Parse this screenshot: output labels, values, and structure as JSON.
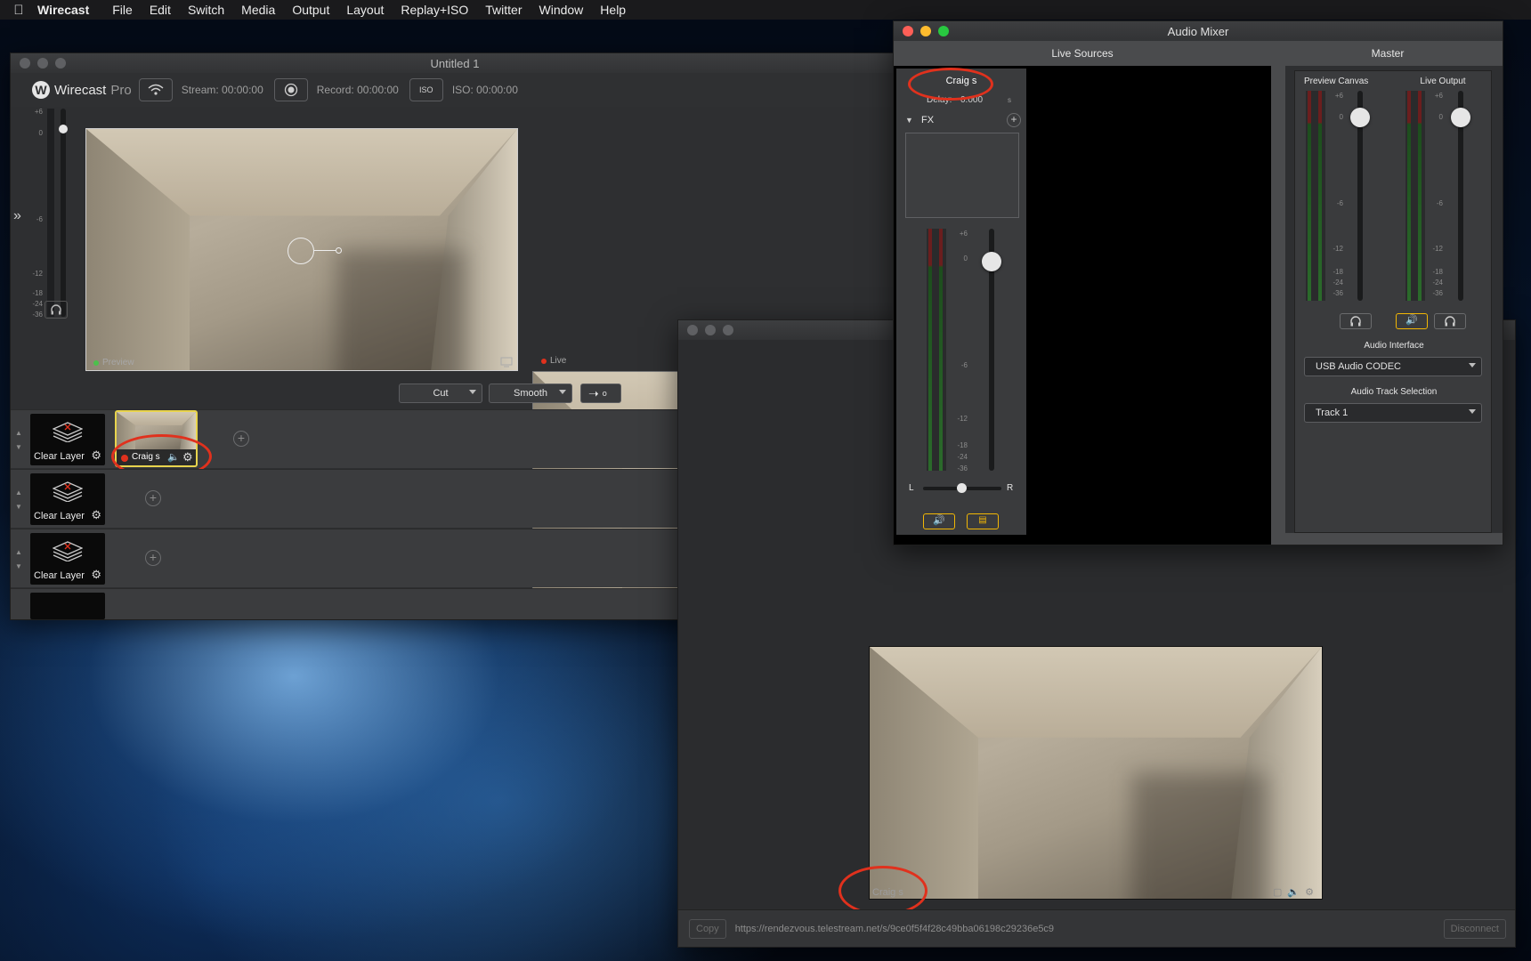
{
  "menubar": {
    "app": "Wirecast",
    "items": [
      "File",
      "Edit",
      "Switch",
      "Media",
      "Output",
      "Layout",
      "Replay+ISO",
      "Twitter",
      "Window",
      "Help"
    ]
  },
  "main": {
    "title": "Untitled 1",
    "logo": "Wirecast",
    "logo_suffix": "Pro",
    "stream": "Stream: 00:00:00",
    "record": "Record: 00:00:00",
    "iso": "ISO: 00:00:00",
    "iso_btn": "ISO",
    "scale": [
      "+6",
      "0",
      "-6",
      "-12",
      "-18",
      "-24",
      "-36"
    ],
    "preview_label": "Preview",
    "live_label": "Live",
    "transition_1": "Cut",
    "transition_2": "Smooth",
    "go_marker": "o",
    "layers": [
      {
        "label": "Clear Layer"
      },
      {
        "label": "Clear Layer"
      },
      {
        "label": "Clear Layer"
      }
    ],
    "shot_label": "Craig s"
  },
  "mixer": {
    "title": "Audio Mixer",
    "tab_live": "Live Sources",
    "tab_master": "Master",
    "source_name": "Craig s",
    "delay_label": "Delay:",
    "delay_value": "0.000",
    "delay_unit": "s",
    "fx_label": "FX",
    "pan_left": "L",
    "pan_right": "R",
    "scale": [
      "+6",
      "0",
      "-6",
      "-12",
      "-18",
      "-24",
      "-36"
    ],
    "preview_canvas": "Preview Canvas",
    "live_output": "Live Output",
    "audio_interface_label": "Audio Interface",
    "audio_interface_value": "USB Audio CODEC",
    "track_label": "Audio Track Selection",
    "track_value": "Track 1",
    "accent": "#f2b705"
  },
  "guest": {
    "name": "Craig s",
    "copy": "Copy",
    "url": "https://rendezvous.telestream.net/s/9ce0f5f4f28c49bba06198c29236e5c9",
    "disconnect": "Disconnect"
  },
  "colors": {
    "annotation_ring": "#e0311d",
    "selected_border": "#e8d44d",
    "preview_dot": "#4cc04c",
    "live_dot": "#e0311d"
  }
}
